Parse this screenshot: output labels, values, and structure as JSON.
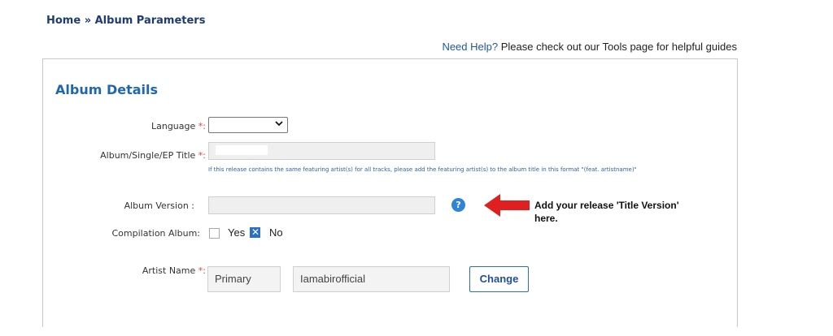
{
  "breadcrumb": {
    "text": "Home » Album Parameters"
  },
  "help": {
    "link": "Need Help?",
    "text": " Please check out our Tools page for helpful guides"
  },
  "section": {
    "title": "Album Details"
  },
  "fields": {
    "language": {
      "label": "Language",
      "required": "*:",
      "value": ""
    },
    "title": {
      "label": "Album/Single/EP Title",
      "required": "*:"
    },
    "title_hint": "If this release contains the same featuring artist(s) for all tracks, please add the featuring artist(s) to the album title in this format \"(feat. artistname)\"",
    "version": {
      "label": "Album Version :",
      "value": ""
    },
    "compilation": {
      "label": "Compilation Album:",
      "yes": "Yes",
      "no": "No",
      "selected": "No"
    },
    "artist": {
      "label": "Artist Name",
      "required": "*:",
      "role": "Primary",
      "name": "Iamabirofficial",
      "change_label": "Change"
    }
  },
  "annotation": {
    "text": "Add your release 'Title Version' here.",
    "color": "#e02020"
  },
  "icons": {
    "help": "question-circle-icon",
    "checked": "x-check-icon",
    "arrow": "left-arrow-icon"
  }
}
